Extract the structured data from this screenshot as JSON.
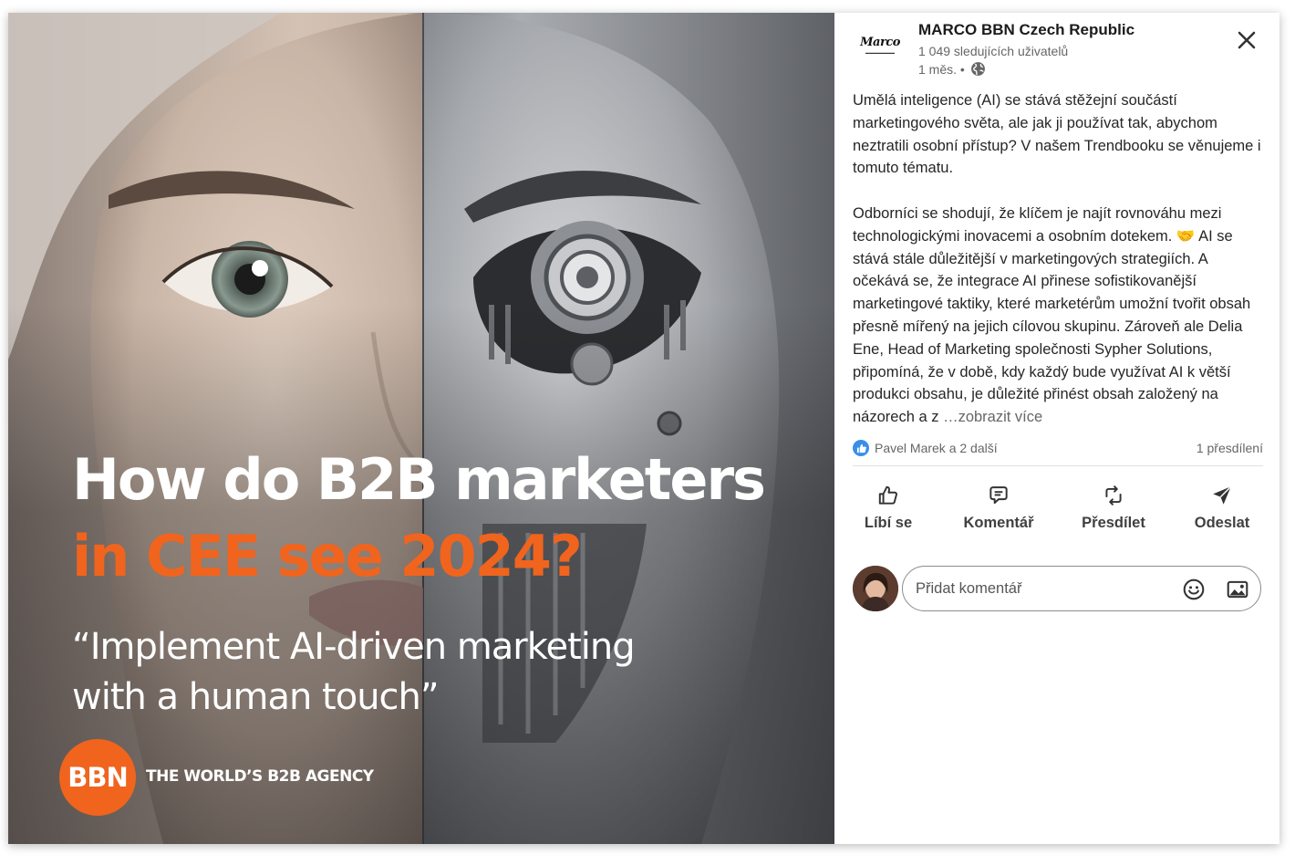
{
  "image": {
    "headline_white": "How do B2B marketers",
    "headline_orange": "in CEE see 2024?",
    "quote_line1": "“Implement AI-driven marketing",
    "quote_line2": "with a human touch”",
    "brand_logo": "BBN",
    "tagline": "THE WORLD’S B2B AGENCY"
  },
  "post": {
    "company_logo_text": "Marco",
    "company_name": "MARCO BBN Czech Republic",
    "followers": "1 049 sledujících uživatelů",
    "time": "1 měs. •",
    "visibility_icon": "globe-icon",
    "paragraph1": "Umělá inteligence (AI) se stává stěžejní součástí marketingového světa, ale jak ji používat tak, abychom neztratili osobní přístup? V našem Trendbooku se věnujeme i tomuto tématu.",
    "paragraph2": "Odborníci se shodují, že klíčem je najít rovnováhu mezi technologickými inovacemi a osobním dotekem. 🤝 AI se stává stále důležitější v marketingových strategiích. A očekává se, že integrace AI přinese sofistikovanější marketingové taktiky, které marketérům umožní tvořit obsah přesně mířený na jejich cílovou skupinu. Zároveň ale Delia Ene, Head of Marketing společnosti Sypher Solutions, připomíná, že v době, kdy každý bude využívat AI k větší produkci obsahu, je důležité přinést obsah založený na názorech a z ",
    "see_more": "…zobrazit více",
    "reactions_text": "Pavel Marek a 2 další",
    "reshares": "1 přesdílení"
  },
  "actions": {
    "like": "Líbí se",
    "comment": "Komentář",
    "repost": "Přesdílet",
    "send": "Odeslat"
  },
  "comment": {
    "placeholder": "Přidat komentář"
  },
  "colors": {
    "accent_orange": "#f0641e",
    "like_blue": "#378fe9"
  }
}
